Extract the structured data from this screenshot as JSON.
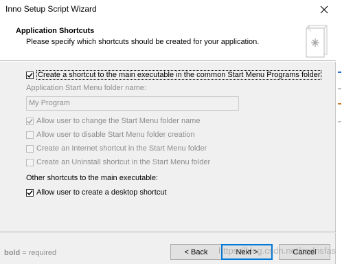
{
  "window": {
    "title": "Inno Setup Script Wizard"
  },
  "header": {
    "title": "Application Shortcuts",
    "subtitle": "Please specify which shortcuts should be created for your application.",
    "image_icon": "setup-wizard-page-icon"
  },
  "options": {
    "create_start_menu_shortcut": {
      "label": "Create a shortcut to the main executable in the common Start Menu Programs folder",
      "checked": true
    },
    "folder_name_label": "Application Start Menu folder name:",
    "folder_name_value": "My Program",
    "allow_change_folder": {
      "label": "Allow user to change the Start Menu folder name",
      "checked": true,
      "enabled": false
    },
    "allow_disable_folder": {
      "label": "Allow user to disable Start Menu folder creation",
      "checked": false,
      "enabled": false
    },
    "internet_shortcut": {
      "label": "Create an Internet shortcut in the Start Menu folder",
      "checked": false,
      "enabled": false
    },
    "uninstall_shortcut": {
      "label": "Create an Uninstall shortcut in the Start Menu folder",
      "checked": false,
      "enabled": false
    },
    "other_shortcuts_label": "Other shortcuts to the main executable:",
    "desktop_shortcut": {
      "label": "Allow user to create a desktop shortcut",
      "checked": true
    }
  },
  "footer": {
    "legend_bold": "bold",
    "legend_rest": " = required",
    "back_label": "< Back",
    "next_label": "Next >",
    "cancel_label": "Cancel"
  },
  "watermark": "https://blog.csdn.net/csdnsfasfasfo",
  "colors": {
    "dialog_bg": "#f0f0f0",
    "header_bg": "#ffffff",
    "disabled_text": "#8d8d8d",
    "focus_accent": "#0078d7"
  }
}
